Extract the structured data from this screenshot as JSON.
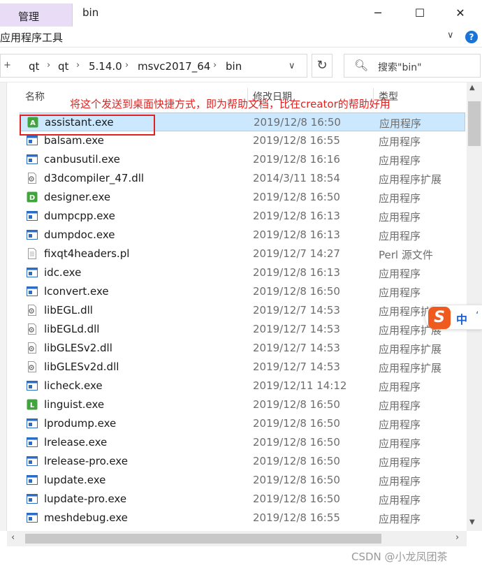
{
  "window": {
    "manage_tab": "管理",
    "title": "bin",
    "ribbon_label": "应用程序工具"
  },
  "address": {
    "crumbs": [
      "qt",
      "qt",
      "5.14.0",
      "msvc2017_64",
      "bin"
    ],
    "search_placeholder": "搜索\"bin\""
  },
  "columns": {
    "name": "名称",
    "date": "修改日期",
    "type": "类型"
  },
  "annotation": "将这个发送到桌面快捷方式，即为帮助文档，比在creator的帮助好用",
  "files": [
    {
      "name": "assistant.exe",
      "date": "2019/12/8 16:50",
      "type": "应用程序",
      "icon": "assistant-app-icon"
    },
    {
      "name": "balsam.exe",
      "date": "2019/12/8 16:55",
      "type": "应用程序",
      "icon": "exe-icon"
    },
    {
      "name": "canbusutil.exe",
      "date": "2019/12/8 16:16",
      "type": "应用程序",
      "icon": "exe-icon"
    },
    {
      "name": "d3dcompiler_47.dll",
      "date": "2014/3/11 18:54",
      "type": "应用程序扩展",
      "icon": "dll-icon"
    },
    {
      "name": "designer.exe",
      "date": "2019/12/8 16:50",
      "type": "应用程序",
      "icon": "designer-app-icon"
    },
    {
      "name": "dumpcpp.exe",
      "date": "2019/12/8 16:13",
      "type": "应用程序",
      "icon": "exe-icon"
    },
    {
      "name": "dumpdoc.exe",
      "date": "2019/12/8 16:13",
      "type": "应用程序",
      "icon": "exe-icon"
    },
    {
      "name": "fixqt4headers.pl",
      "date": "2019/12/7 14:27",
      "type": "Perl 源文件",
      "icon": "text-file-icon"
    },
    {
      "name": "idc.exe",
      "date": "2019/12/8 16:13",
      "type": "应用程序",
      "icon": "exe-icon"
    },
    {
      "name": "lconvert.exe",
      "date": "2019/12/8 16:50",
      "type": "应用程序",
      "icon": "exe-icon"
    },
    {
      "name": "libEGL.dll",
      "date": "2019/12/7 14:53",
      "type": "应用程序扩展",
      "icon": "dll-icon"
    },
    {
      "name": "libEGLd.dll",
      "date": "2019/12/7 14:53",
      "type": "应用程序扩展",
      "icon": "dll-icon"
    },
    {
      "name": "libGLESv2.dll",
      "date": "2019/12/7 14:53",
      "type": "应用程序扩展",
      "icon": "dll-icon"
    },
    {
      "name": "libGLESv2d.dll",
      "date": "2019/12/7 14:53",
      "type": "应用程序扩展",
      "icon": "dll-icon"
    },
    {
      "name": "licheck.exe",
      "date": "2019/12/11 14:12",
      "type": "应用程序",
      "icon": "exe-icon"
    },
    {
      "name": "linguist.exe",
      "date": "2019/12/8 16:50",
      "type": "应用程序",
      "icon": "linguist-app-icon"
    },
    {
      "name": "lprodump.exe",
      "date": "2019/12/8 16:50",
      "type": "应用程序",
      "icon": "exe-icon"
    },
    {
      "name": "lrelease.exe",
      "date": "2019/12/8 16:50",
      "type": "应用程序",
      "icon": "exe-icon"
    },
    {
      "name": "lrelease-pro.exe",
      "date": "2019/12/8 16:50",
      "type": "应用程序",
      "icon": "exe-icon"
    },
    {
      "name": "lupdate.exe",
      "date": "2019/12/8 16:50",
      "type": "应用程序",
      "icon": "exe-icon"
    },
    {
      "name": "lupdate-pro.exe",
      "date": "2019/12/8 16:50",
      "type": "应用程序",
      "icon": "exe-icon"
    },
    {
      "name": "meshdebug.exe",
      "date": "2019/12/8 16:55",
      "type": "应用程序",
      "icon": "exe-icon"
    }
  ],
  "ime": {
    "logo": "S",
    "mode": "中"
  },
  "watermark": "CSDN @小龙凤团茶",
  "colors": {
    "selection": "#cce8ff",
    "annotation_red": "#e0211f",
    "manage_tab": "#e9dcf7",
    "ime_orange": "#ef5a1f"
  }
}
